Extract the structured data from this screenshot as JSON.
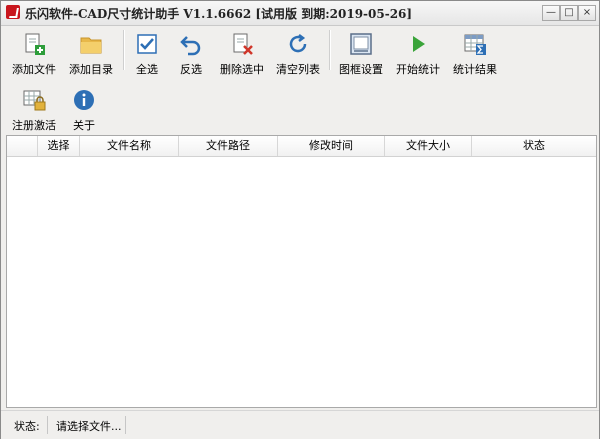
{
  "window": {
    "title": "乐闪软件-CAD尺寸统计助手 V1.1.6662 [试用版 到期:2019-05-26]",
    "controls": {
      "minimize": "—",
      "maximize": "□",
      "close": "×"
    }
  },
  "toolbar": {
    "row1": [
      {
        "label": "添加文件",
        "icon": "add-file-icon"
      },
      {
        "label": "添加目录",
        "icon": "folder-icon"
      },
      {
        "label": "全选",
        "icon": "checkbox-checked-icon"
      },
      {
        "label": "反选",
        "icon": "undo-arrow-icon"
      },
      {
        "label": "删除选中",
        "icon": "delete-doc-icon"
      },
      {
        "label": "清空列表",
        "icon": "refresh-icon"
      },
      {
        "label": "图框设置",
        "icon": "frame-icon"
      },
      {
        "label": "开始统计",
        "icon": "play-icon"
      },
      {
        "label": "统计结果",
        "icon": "table-sum-icon"
      }
    ],
    "row2": [
      {
        "label": "注册激活",
        "icon": "lock-grid-icon"
      },
      {
        "label": "关于",
        "icon": "info-icon"
      }
    ]
  },
  "grid": {
    "columns": [
      "选择",
      "文件名称",
      "文件路径",
      "修改时间",
      "文件大小",
      "状态"
    ],
    "rows": []
  },
  "status": {
    "label": "状态:",
    "message": "请选择文件..."
  },
  "colors": {
    "accent_blue": "#2d6fb5",
    "play_green": "#3aa43a",
    "delete_red": "#d0362a",
    "folder_yellow": "#e8b84a"
  }
}
